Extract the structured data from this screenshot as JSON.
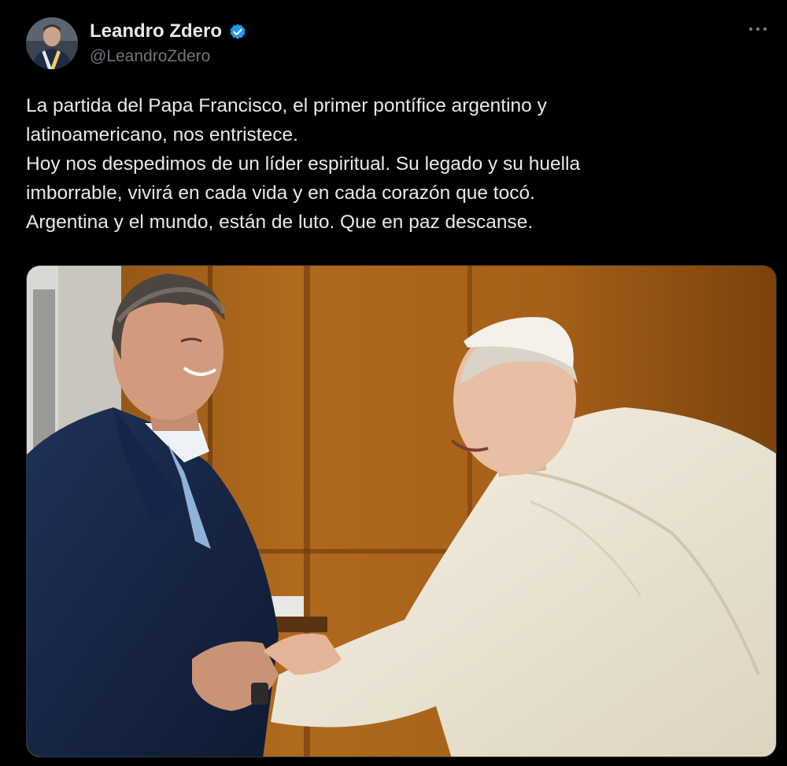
{
  "author": {
    "display_name": "Leandro Zdero",
    "handle": "@LeandroZdero",
    "verified_icon": "verified-badge-icon",
    "verified_color": "#1d9bf0"
  },
  "more_icon": "more-options-icon",
  "tweet_text_lines": [
    "La partida del Papa Francisco, el primer pontífice argentino y",
    "latinoamericano, nos entristece.",
    "Hoy nos despedimos de un líder espiritual. Su legado y su huella",
    "imborrable, vivirá en cada vida y en cada corazón que tocó.",
    "Argentina y el mundo, están de luto. Que en paz descanse."
  ],
  "colors": {
    "background": "#000000",
    "text": "#e7e9ea",
    "secondary_text": "#71767b"
  }
}
